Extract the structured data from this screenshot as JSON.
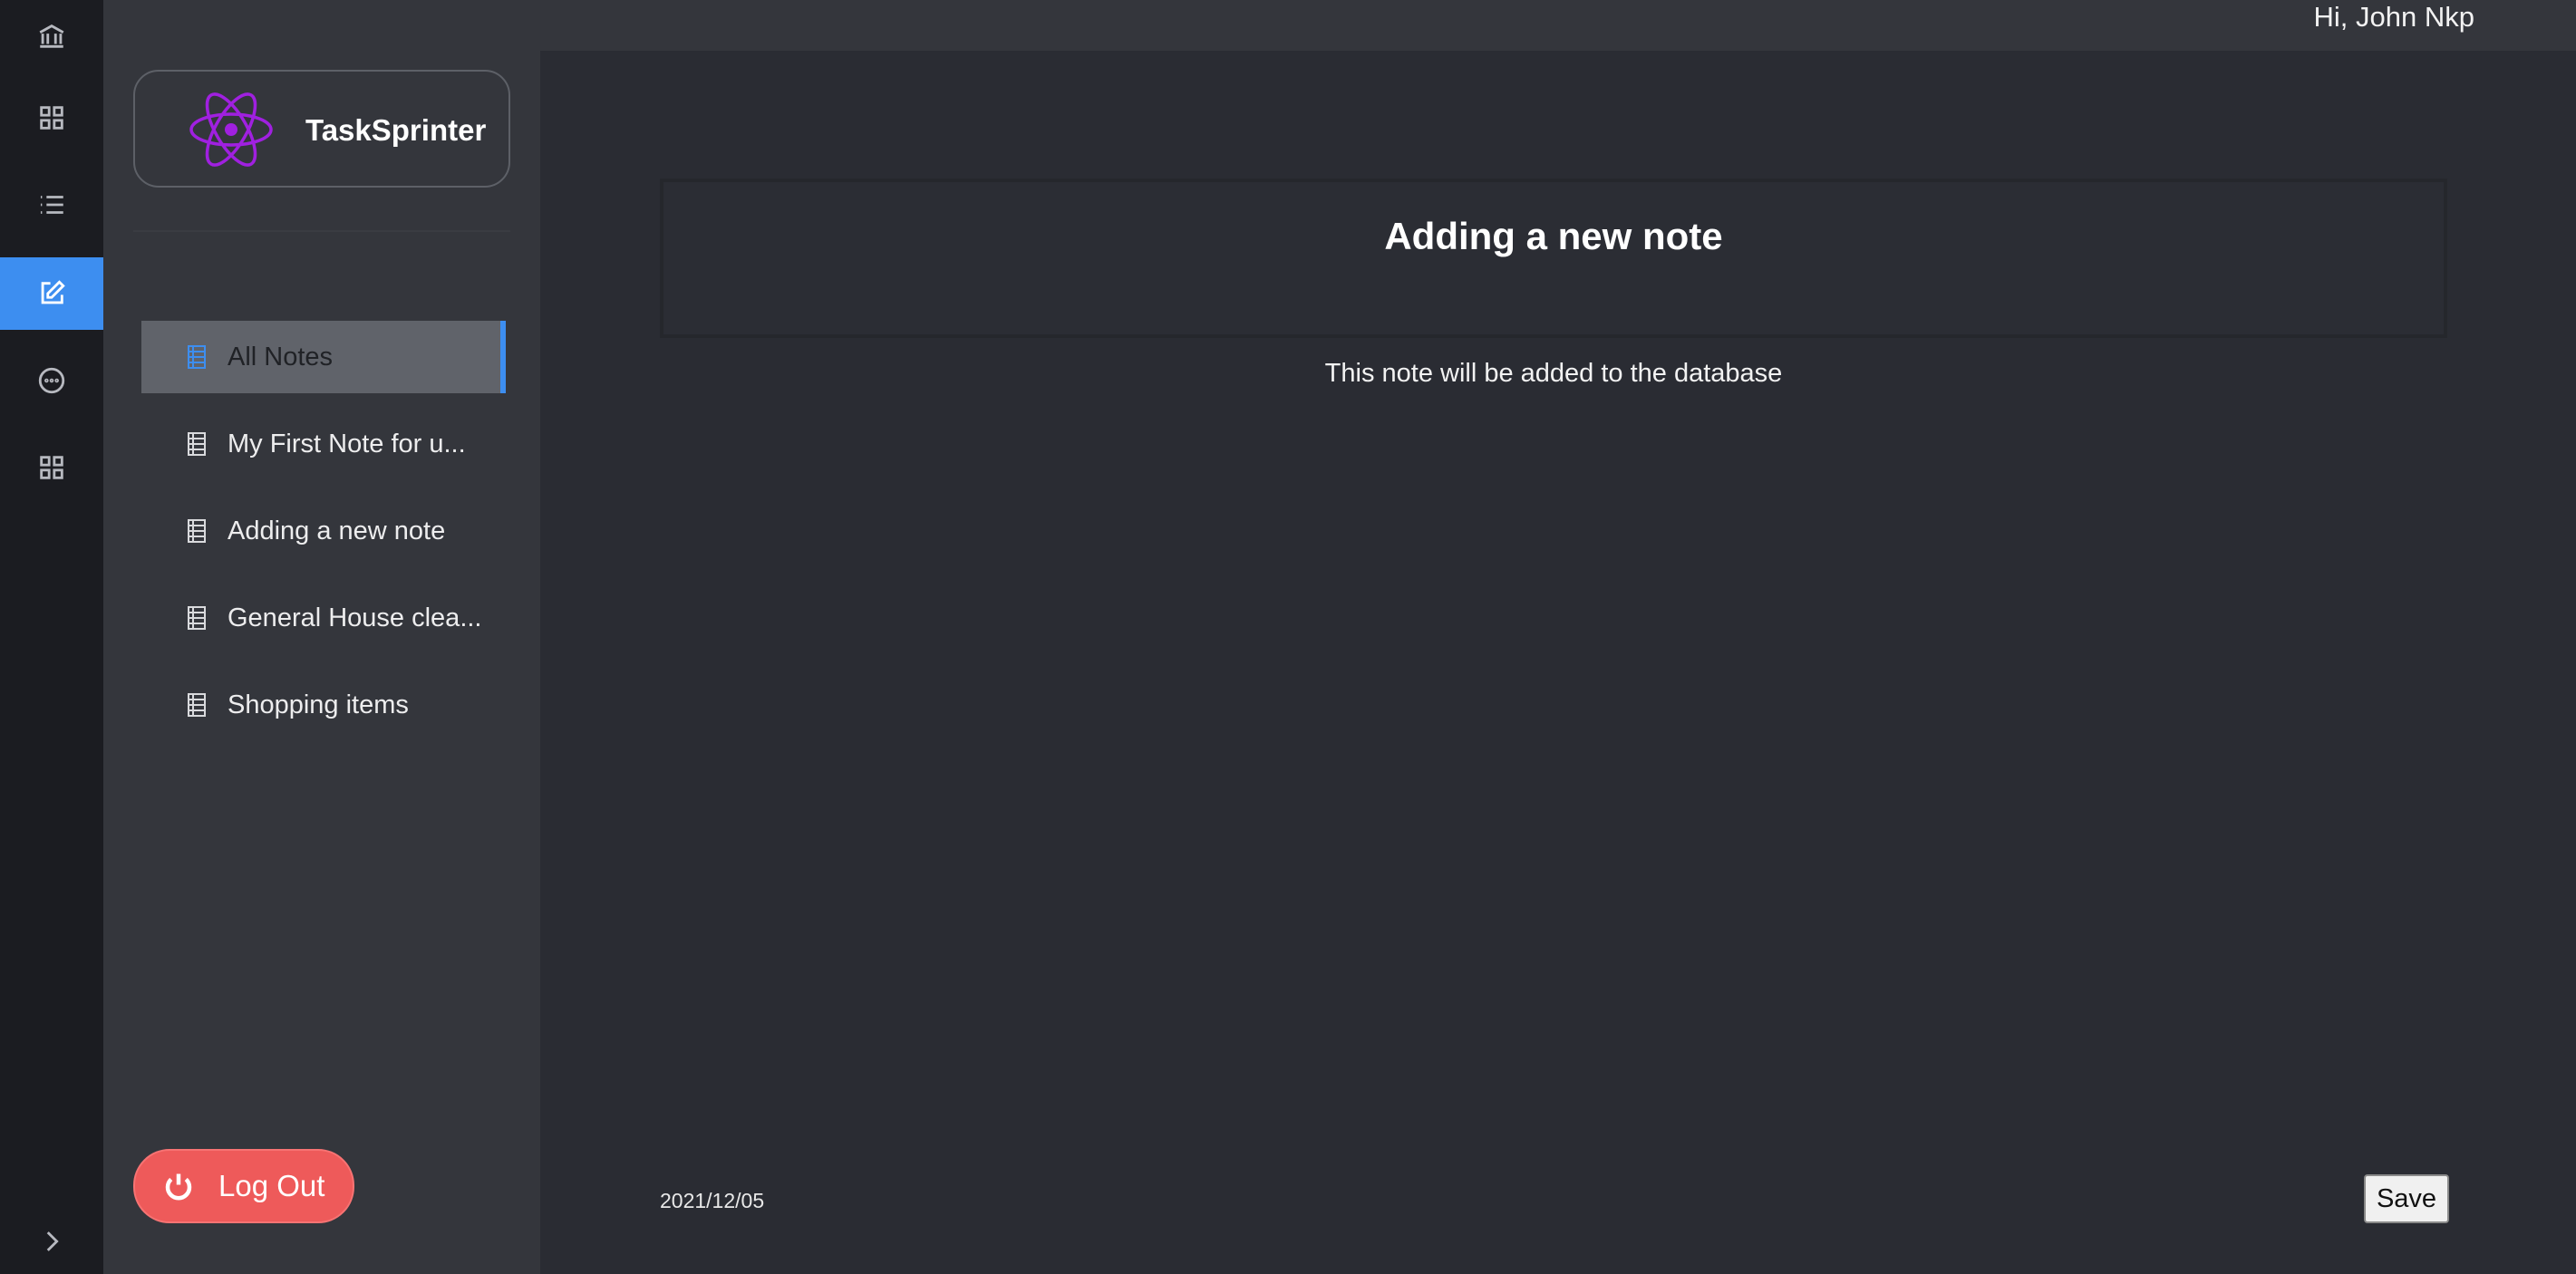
{
  "header": {
    "greeting": "Hi, John Nkp"
  },
  "brand": {
    "name": "TaskSprinter",
    "logo_icon": "atom-icon",
    "logo_color": "#a020e0"
  },
  "rail": {
    "items": [
      {
        "icon": "bank-icon",
        "active": false
      },
      {
        "icon": "grid-icon",
        "active": false
      },
      {
        "icon": "list-icon",
        "active": false
      },
      {
        "icon": "edit-icon",
        "active": true
      },
      {
        "icon": "chat-icon",
        "active": false
      },
      {
        "icon": "apps-icon",
        "active": false
      }
    ],
    "expand_icon": "chevron-right-icon",
    "accent": "#3d8ef0"
  },
  "sidebar": {
    "items": [
      {
        "label": "All Notes",
        "icon": "note-icon",
        "active": true
      },
      {
        "label": "My First Note for u...",
        "icon": "note-icon",
        "active": false
      },
      {
        "label": "Adding a new note",
        "icon": "note-icon",
        "active": false
      },
      {
        "label": "General House clea...",
        "icon": "note-icon",
        "active": false
      },
      {
        "label": "Shopping items",
        "icon": "note-icon",
        "active": false
      }
    ],
    "logout_label": "Log Out",
    "logout_color": "#ee5a5a"
  },
  "note": {
    "title": "Adding a new note",
    "body": "This note will be added to the database",
    "date": "2021/12/05",
    "save_label": "Save"
  }
}
